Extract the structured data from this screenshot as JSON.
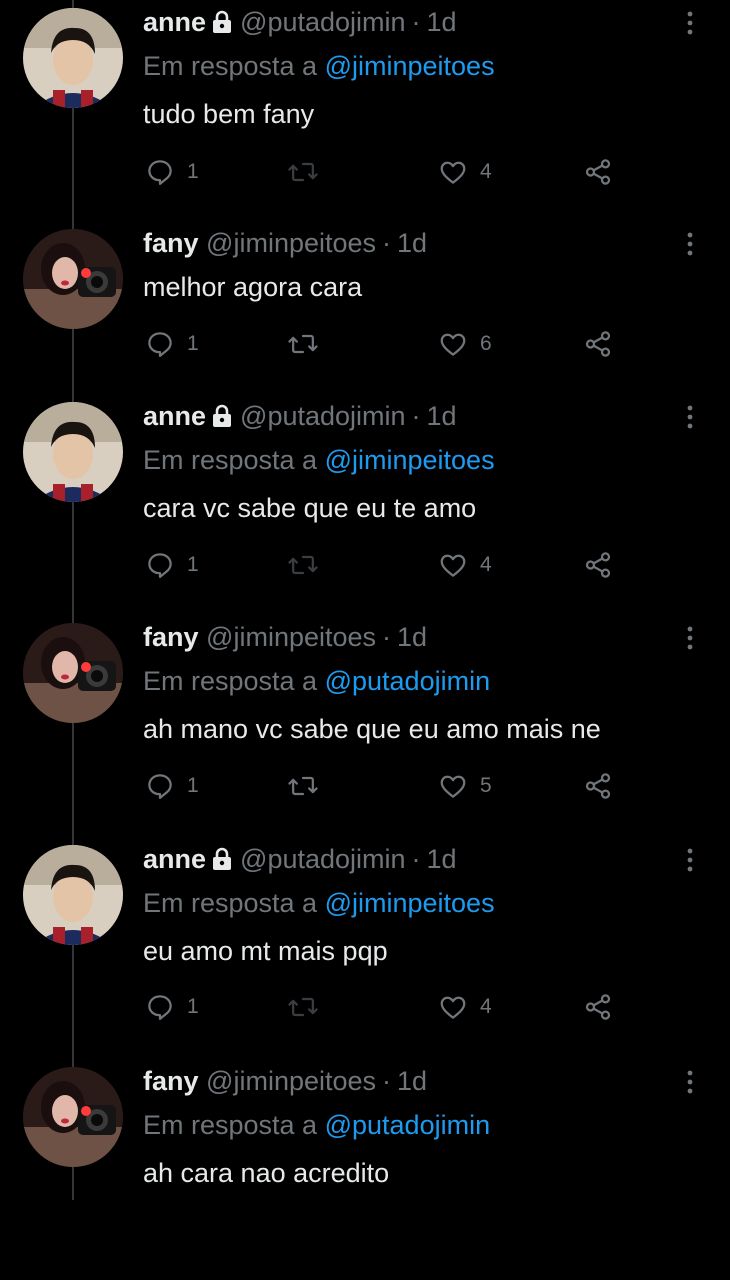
{
  "colors": {
    "background": "#000000",
    "text": "#e7e9ea",
    "muted": "#71767b",
    "link": "#1d9bf0",
    "thread_line": "#333639"
  },
  "tweets": [
    {
      "name": "anne",
      "locked": true,
      "handle": "@putadojimin",
      "time": "1d",
      "reply_prefix": "Em resposta a",
      "reply_to": "@jiminpeitoes",
      "text": "tudo bem fany",
      "replies": "1",
      "likes": "4",
      "avatar": "anne"
    },
    {
      "name": "fany",
      "locked": false,
      "handle": "@jiminpeitoes",
      "time": "1d",
      "reply_prefix": "",
      "reply_to": "",
      "text": "melhor agora cara",
      "replies": "1",
      "likes": "6",
      "avatar": "fany"
    },
    {
      "name": "anne",
      "locked": true,
      "handle": "@putadojimin",
      "time": "1d",
      "reply_prefix": "Em resposta a",
      "reply_to": "@jiminpeitoes",
      "text": "cara vc sabe que eu te amo",
      "replies": "1",
      "likes": "4",
      "avatar": "anne"
    },
    {
      "name": "fany",
      "locked": false,
      "handle": "@jiminpeitoes",
      "time": "1d",
      "reply_prefix": "Em resposta a",
      "reply_to": "@putadojimin",
      "text": "ah mano vc sabe que eu amo mais ne",
      "replies": "1",
      "likes": "5",
      "avatar": "fany"
    },
    {
      "name": "anne",
      "locked": true,
      "handle": "@putadojimin",
      "time": "1d",
      "reply_prefix": "Em resposta a",
      "reply_to": "@jiminpeitoes",
      "text": "eu amo mt mais pqp",
      "replies": "1",
      "likes": "4",
      "avatar": "anne"
    },
    {
      "name": "fany",
      "locked": false,
      "handle": "@jiminpeitoes",
      "time": "1d",
      "reply_prefix": "Em resposta a",
      "reply_to": "@putadojimin",
      "text": "ah cara nao acredito",
      "replies": "",
      "likes": "",
      "avatar": "fany"
    }
  ],
  "icons": [
    "lock-icon",
    "more-icon",
    "reply-icon",
    "retweet-icon",
    "like-icon",
    "share-icon"
  ]
}
